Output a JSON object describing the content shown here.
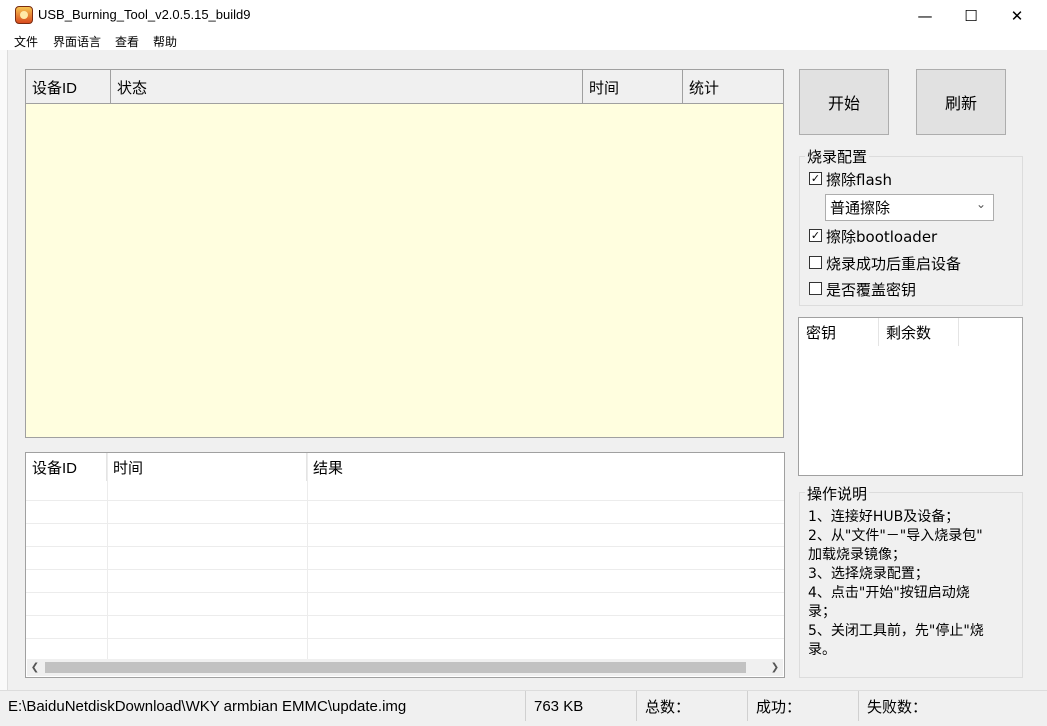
{
  "window": {
    "title": "USB_Burning_Tool_v2.0.5.15_build9",
    "controls": {
      "minimize": "—",
      "maximize": "☐",
      "close": "✕"
    }
  },
  "menu": [
    "文件",
    "界面语言",
    "查看",
    "帮助"
  ],
  "device_table": {
    "columns": [
      "设备ID",
      "状态",
      "时间",
      "统计"
    ]
  },
  "log_table": {
    "columns": [
      "设备ID",
      "时间",
      "结果"
    ]
  },
  "buttons": {
    "start": "开始",
    "refresh": "刷新"
  },
  "burn_config": {
    "title": "烧录配置",
    "erase_flash": {
      "label": "擦除flash",
      "checked": true
    },
    "erase_mode": "普通擦除",
    "erase_bootloader": {
      "label": "擦除bootloader",
      "checked": true
    },
    "reboot_after": {
      "label": "烧录成功后重启设备",
      "checked": false
    },
    "overwrite_key": {
      "label": "是否覆盖密钥",
      "checked": false
    }
  },
  "key_table": {
    "columns": [
      "密钥",
      "剩余数"
    ]
  },
  "instructions": {
    "title": "操作说明",
    "lines": [
      "1、连接好HUB及设备；",
      "2、从\"文件\"－\"导入烧录包\"",
      "加载烧录镜像；",
      "3、选择烧录配置；",
      "4、点击\"开始\"按钮启动烧",
      "录；",
      "5、关闭工具前，先\"停止\"烧",
      "录。"
    ]
  },
  "status": {
    "path": "E:\\BaiduNetdiskDownload\\WKY armbian EMMC\\update.img",
    "size": "763 KB",
    "total_label": "总数：",
    "success_label": "成功：",
    "fail_label": "失败数："
  }
}
